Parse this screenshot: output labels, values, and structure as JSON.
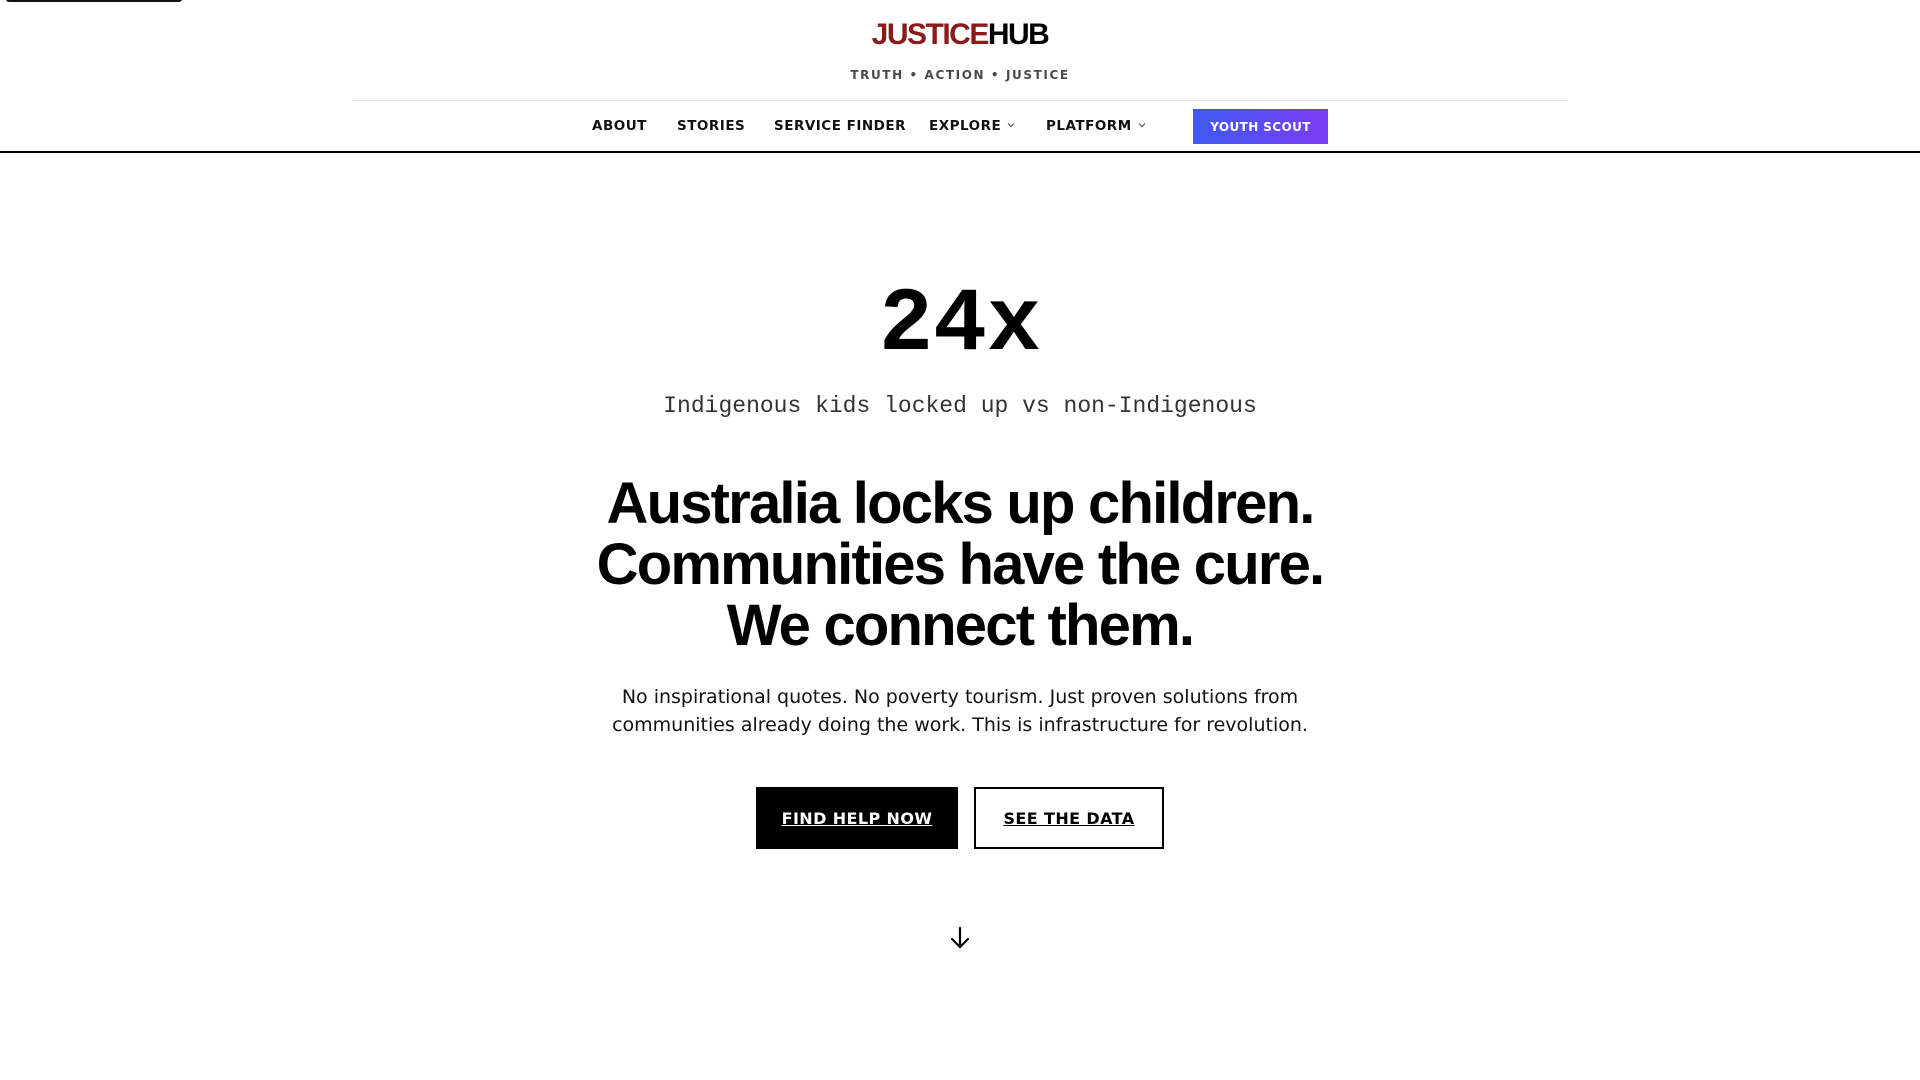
{
  "header": {
    "logo_part1": "JUSTICE",
    "logo_part2": "HUB",
    "tagline": "TRUTH • ACTION • JUSTICE"
  },
  "nav": {
    "items": [
      {
        "label": "ABOUT"
      },
      {
        "label": "STORIES"
      },
      {
        "label": "SERVICE FINDER"
      },
      {
        "label": "EXPLORE",
        "icon": "chevron-down-icon"
      },
      {
        "label": "PLATFORM",
        "icon": "chevron-down-icon"
      }
    ],
    "cta_label": "YOUTH SCOUT"
  },
  "hero": {
    "stat_value": "24x",
    "stat_caption": "Indigenous kids locked up vs non-Indigenous",
    "headline_lines": [
      "Australia locks up children.",
      "Communities have the cure.",
      "We connect them."
    ],
    "subtext_lines": [
      "No inspirational quotes. No poverty tourism. Just proven solutions from",
      "communities already doing the work. This is infrastructure for revolution."
    ],
    "primary_button": "FIND HELP NOW",
    "secondary_button": "SEE THE DATA",
    "scroll_icon": "arrow-down-icon"
  },
  "colors": {
    "logo_accent": "#8b1a1a",
    "cta_gradient_start": "#3d5af1",
    "cta_gradient_end": "#7b3cf0",
    "primary_button_bg": "#000000"
  }
}
